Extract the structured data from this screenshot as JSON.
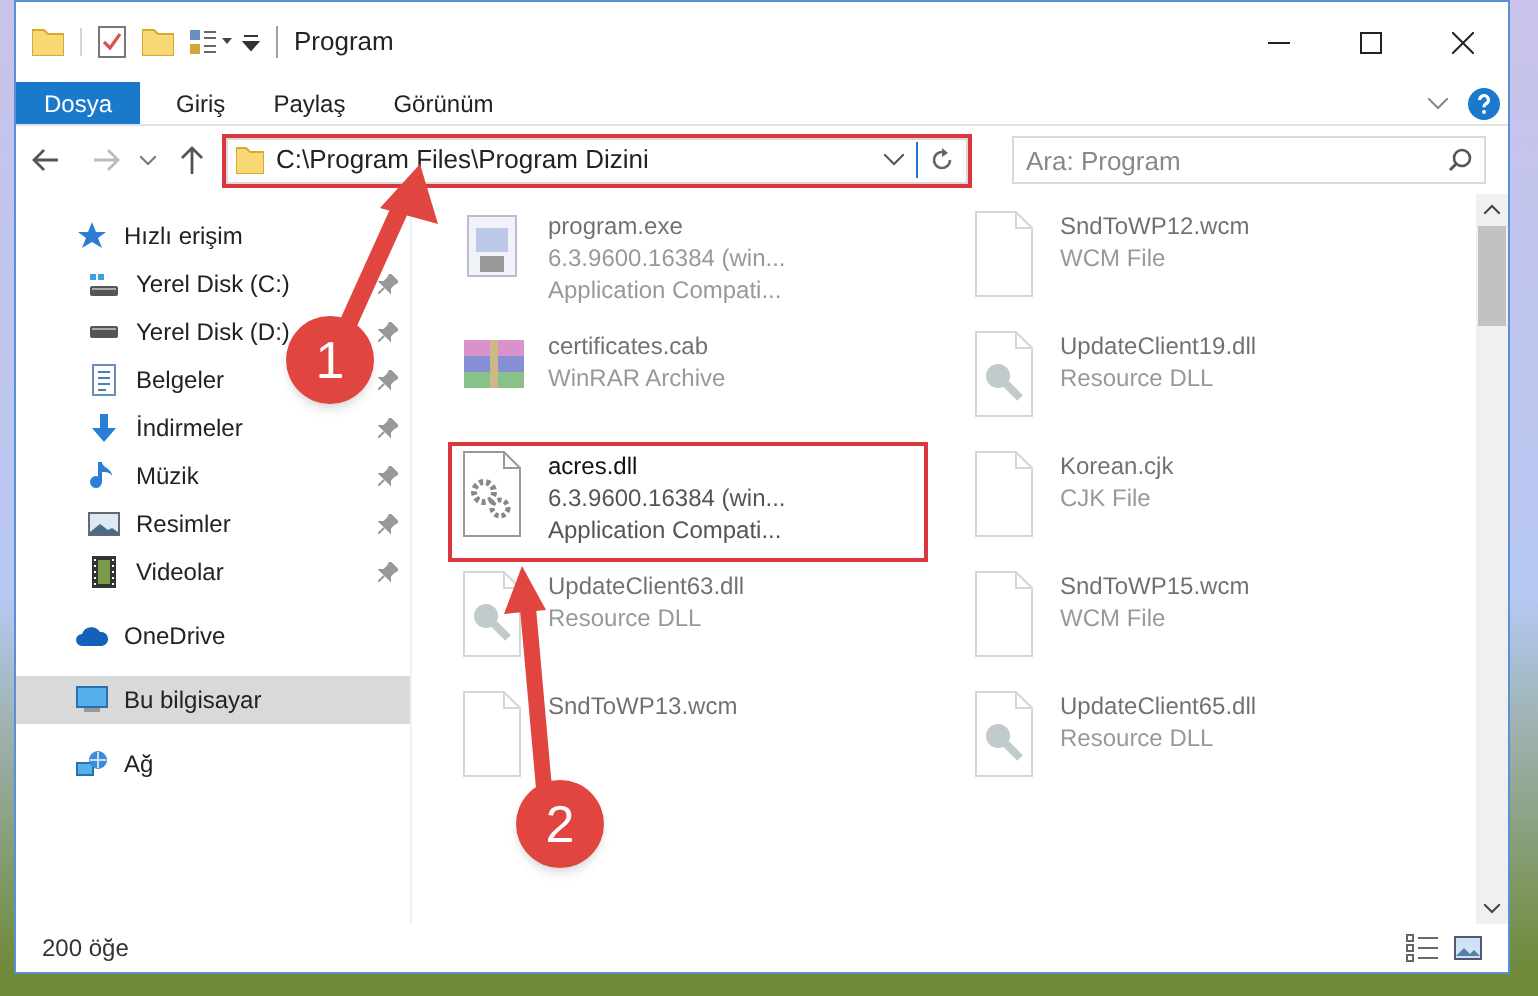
{
  "window": {
    "title": "Program"
  },
  "ribbon_tabs": [
    {
      "label": "Dosya",
      "selected": true
    },
    {
      "label": "Giriş",
      "selected": false
    },
    {
      "label": "Paylaş",
      "selected": false
    },
    {
      "label": "Görünüm",
      "selected": false
    }
  ],
  "address_bar": {
    "value": "C:\\Program Files\\Program Dizini",
    "highlighted": true
  },
  "search": {
    "placeholder": "Ara: Program"
  },
  "sidebar": {
    "items": [
      {
        "label": "Hızlı erişim",
        "kind": "star",
        "selected": false,
        "children": [
          {
            "label": "Yerel Disk (C:)",
            "kind": "system-drive",
            "pinned": true,
            "selected": false
          },
          {
            "label": "Yerel Disk (D:)",
            "kind": "drive",
            "pinned": true,
            "selected": false
          },
          {
            "label": "Belgeler",
            "kind": "document",
            "pinned": true,
            "selected": false
          },
          {
            "label": "İndirmeler",
            "kind": "download",
            "pinned": true,
            "selected": false
          },
          {
            "label": "Müzik",
            "kind": "music",
            "pinned": true,
            "selected": false
          },
          {
            "label": "Resimler",
            "kind": "image",
            "pinned": true,
            "selected": false
          },
          {
            "label": "Videolar",
            "kind": "video",
            "pinned": true,
            "selected": false
          }
        ]
      },
      {
        "label": "OneDrive",
        "kind": "cloud",
        "selected": false
      },
      {
        "label": "Bu bilgisayar",
        "kind": "computer",
        "selected": true
      },
      {
        "label": "Ağ",
        "kind": "network",
        "selected": false
      }
    ]
  },
  "files": [
    {
      "name": "program.exe",
      "details": [
        "6.3.9600.16384 (win...",
        "Application Compati..."
      ],
      "kind": "application",
      "faded": true
    },
    {
      "name": "SndToWP12.wcm",
      "details": [
        "WCM File"
      ],
      "kind": "blank",
      "faded": true
    },
    {
      "name": "certificates.cab",
      "details": [
        "WinRAR Archive"
      ],
      "kind": "archive",
      "faded": true
    },
    {
      "name": "UpdateClient19.dll",
      "details": [
        "Resource DLL"
      ],
      "kind": "dll",
      "faded": true
    },
    {
      "name": "acres.dll",
      "details": [
        "6.3.9600.16384 (win...",
        "Application Compati..."
      ],
      "kind": "gear",
      "faded": false,
      "highlighted": true
    },
    {
      "name": "Korean.cjk",
      "details": [
        "CJK File"
      ],
      "kind": "blank",
      "faded": true
    },
    {
      "name": "UpdateClient63.dll",
      "details": [
        "Resource DLL"
      ],
      "kind": "dll",
      "faded": true
    },
    {
      "name": "SndToWP15.wcm",
      "details": [
        "WCM File"
      ],
      "kind": "blank",
      "faded": true
    },
    {
      "name": "SndToWP13.wcm",
      "kind": "blank",
      "faded": true
    },
    {
      "name": "UpdateClient65.dll",
      "details": [
        "Resource DLL"
      ],
      "kind": "dll",
      "faded": true
    }
  ],
  "status_bar": {
    "item_count": "200 öğe"
  },
  "annotations": [
    {
      "label": "1"
    },
    {
      "label": "2"
    }
  ]
}
